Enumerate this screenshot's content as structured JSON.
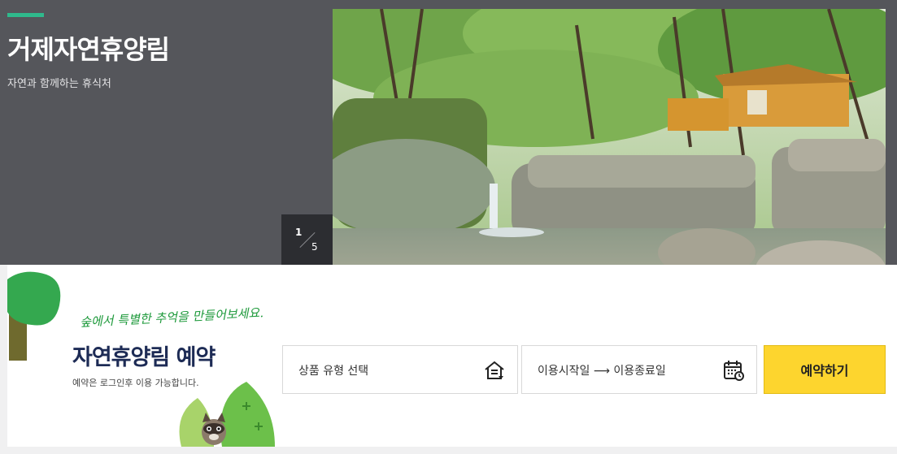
{
  "hero": {
    "title": "거제자연휴양림",
    "subtitle": "자연과 함께하는 휴식처",
    "accent_color": "#2fb98c",
    "band_color": "#55565b"
  },
  "slider": {
    "current": "1",
    "total": "5",
    "prev_icon": "arrow-left-icon",
    "next_icon": "arrow-right-icon"
  },
  "reservation": {
    "slogan": "숲에서 특별한 추억을 만들어보세요.",
    "title_main": "자연휴양림",
    "title_highlight": "예약",
    "note": "예약은 로그인후 이용 가능합니다.",
    "product_type_label": "상품 유형 선택",
    "product_type_icon": "house-list-icon",
    "date_start_label": "이용시작일",
    "date_end_label": "이용종료일",
    "date_arrow": "⟶",
    "date_icon": "calendar-clock-icon",
    "book_button": "예약하기",
    "book_color": "#fdd52e"
  }
}
